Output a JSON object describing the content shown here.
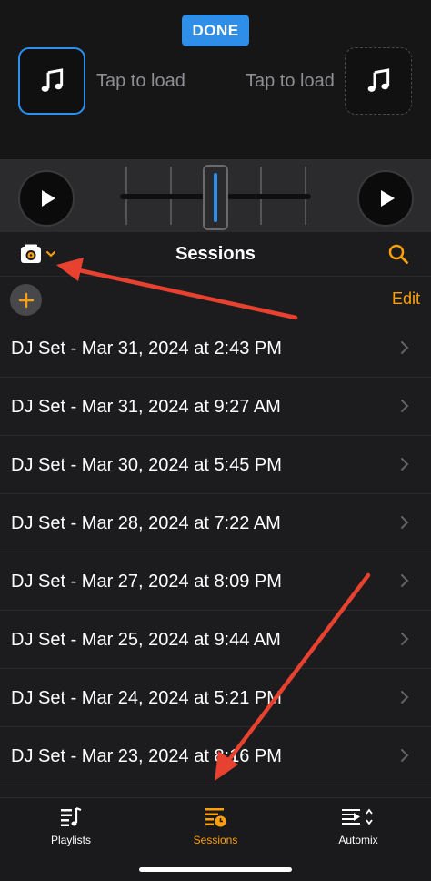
{
  "top": {
    "done_label": "DONE",
    "deck_left_label": "Tap to load",
    "deck_right_label": "Tap to load",
    "deck_icon": "music-note-icon"
  },
  "header": {
    "title": "Sessions",
    "source_icon": "record-box-icon",
    "search_icon": "search-icon"
  },
  "toolbar": {
    "add_icon": "plus-icon",
    "edit_label": "Edit"
  },
  "sessions": [
    "DJ Set - Mar 31, 2024 at 2:43 PM",
    "DJ Set - Mar 31, 2024 at 9:27 AM",
    "DJ Set - Mar 30, 2024 at 5:45 PM",
    "DJ Set - Mar 28, 2024 at 7:22 AM",
    "DJ Set - Mar 27, 2024 at 8:09 PM",
    "DJ Set - Mar 25, 2024 at 9:44 AM",
    "DJ Set - Mar 24, 2024 at 5:21 PM",
    "DJ Set - Mar 23, 2024 at 8:16 PM"
  ],
  "tabs": [
    {
      "label": "Playlists",
      "icon": "playlists-icon"
    },
    {
      "label": "Sessions",
      "icon": "sessions-icon"
    },
    {
      "label": "Automix",
      "icon": "automix-icon"
    }
  ],
  "colors": {
    "accent_orange": "#ff9f0a",
    "accent_blue": "#2f8fe8",
    "annotation_red": "#e8412f"
  }
}
